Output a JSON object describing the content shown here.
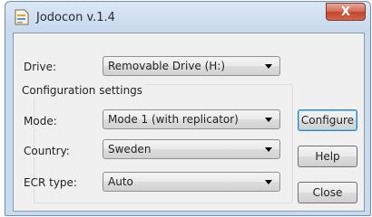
{
  "window": {
    "title": "Jodocon v.1.4",
    "close_glyph": "X",
    "icon": "document-app-icon"
  },
  "form": {
    "drive": {
      "label": "Drive:",
      "value": "Removable Drive (H:)"
    },
    "group_title": "Configuration settings",
    "mode": {
      "label": "Mode:",
      "value": "Mode 1 (with replicator)"
    },
    "country": {
      "label": "Country:",
      "value": "Sweden"
    },
    "ecr_type": {
      "label": "ECR type:",
      "value": "Auto"
    }
  },
  "buttons": {
    "configure": "Configure",
    "help": "Help",
    "close": "Close"
  },
  "colors": {
    "title_bar": "#c9dbee",
    "close_button": "#c1442c",
    "default_button_border": "#3c7fb1"
  }
}
